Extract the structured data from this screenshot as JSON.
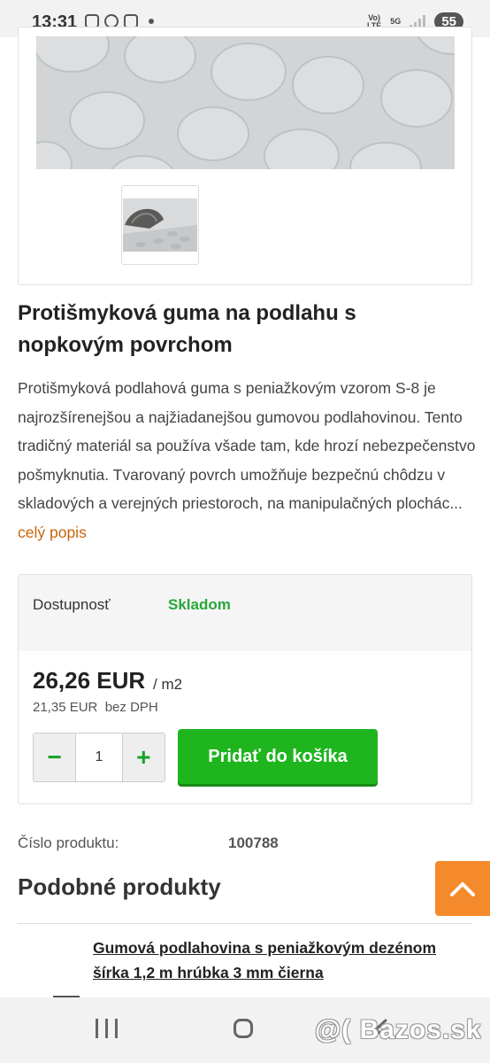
{
  "status_bar": {
    "time": "13:31",
    "network_top": "Vo)",
    "network_bottom": "LTE",
    "fiveg": "5G",
    "battery": "55"
  },
  "product": {
    "title": "Protišmyková guma na podlahu s nopkovým povrchom",
    "description": "Protišmyková podlahová guma s peniažkovým vzorom S-8 je najrozšírenejšou a najžiadanejšou gumovou podlahovinou. Tento tradičný materiál sa používa všade tam, kde hrozí nebezpečenstvo pošmyknutia. Tvarovaný povrch umožňuje bezpečnú chôdzu v skladových a verejných priestoroch, na manipulačných plochác...",
    "more_link": "celý popis"
  },
  "buy_box": {
    "availability_label": "Dostupnosť",
    "availability_value": "Skladom",
    "price": "26,26 EUR",
    "unit": "/ m2",
    "price_net": "21,35 EUR",
    "net_suffix": "bez DPH",
    "quantity": "1",
    "minus_label": "−",
    "plus_label": "+",
    "add_to_cart": "Pridať do košíka"
  },
  "product_number": {
    "label": "Číslo produktu:",
    "value": "100788"
  },
  "similar": {
    "heading": "Podobné produkty",
    "items": [
      {
        "name": "Gumová podlahovina s peniažkovým dezénom šírka 1,2 m hrúbka 3 mm čierna"
      }
    ]
  },
  "watermark": "@( Bazos.sk",
  "colors": {
    "accent_green": "#1fb51f",
    "stock_green": "#27a83a",
    "link_orange": "#c8640f",
    "scroll_button": "#f58a2c"
  },
  "icons": [
    "photo-icon",
    "messenger-icon",
    "gmail-icon",
    "signal-icon",
    "chevron-up-icon",
    "recents-icon",
    "home-icon",
    "back-icon"
  ]
}
